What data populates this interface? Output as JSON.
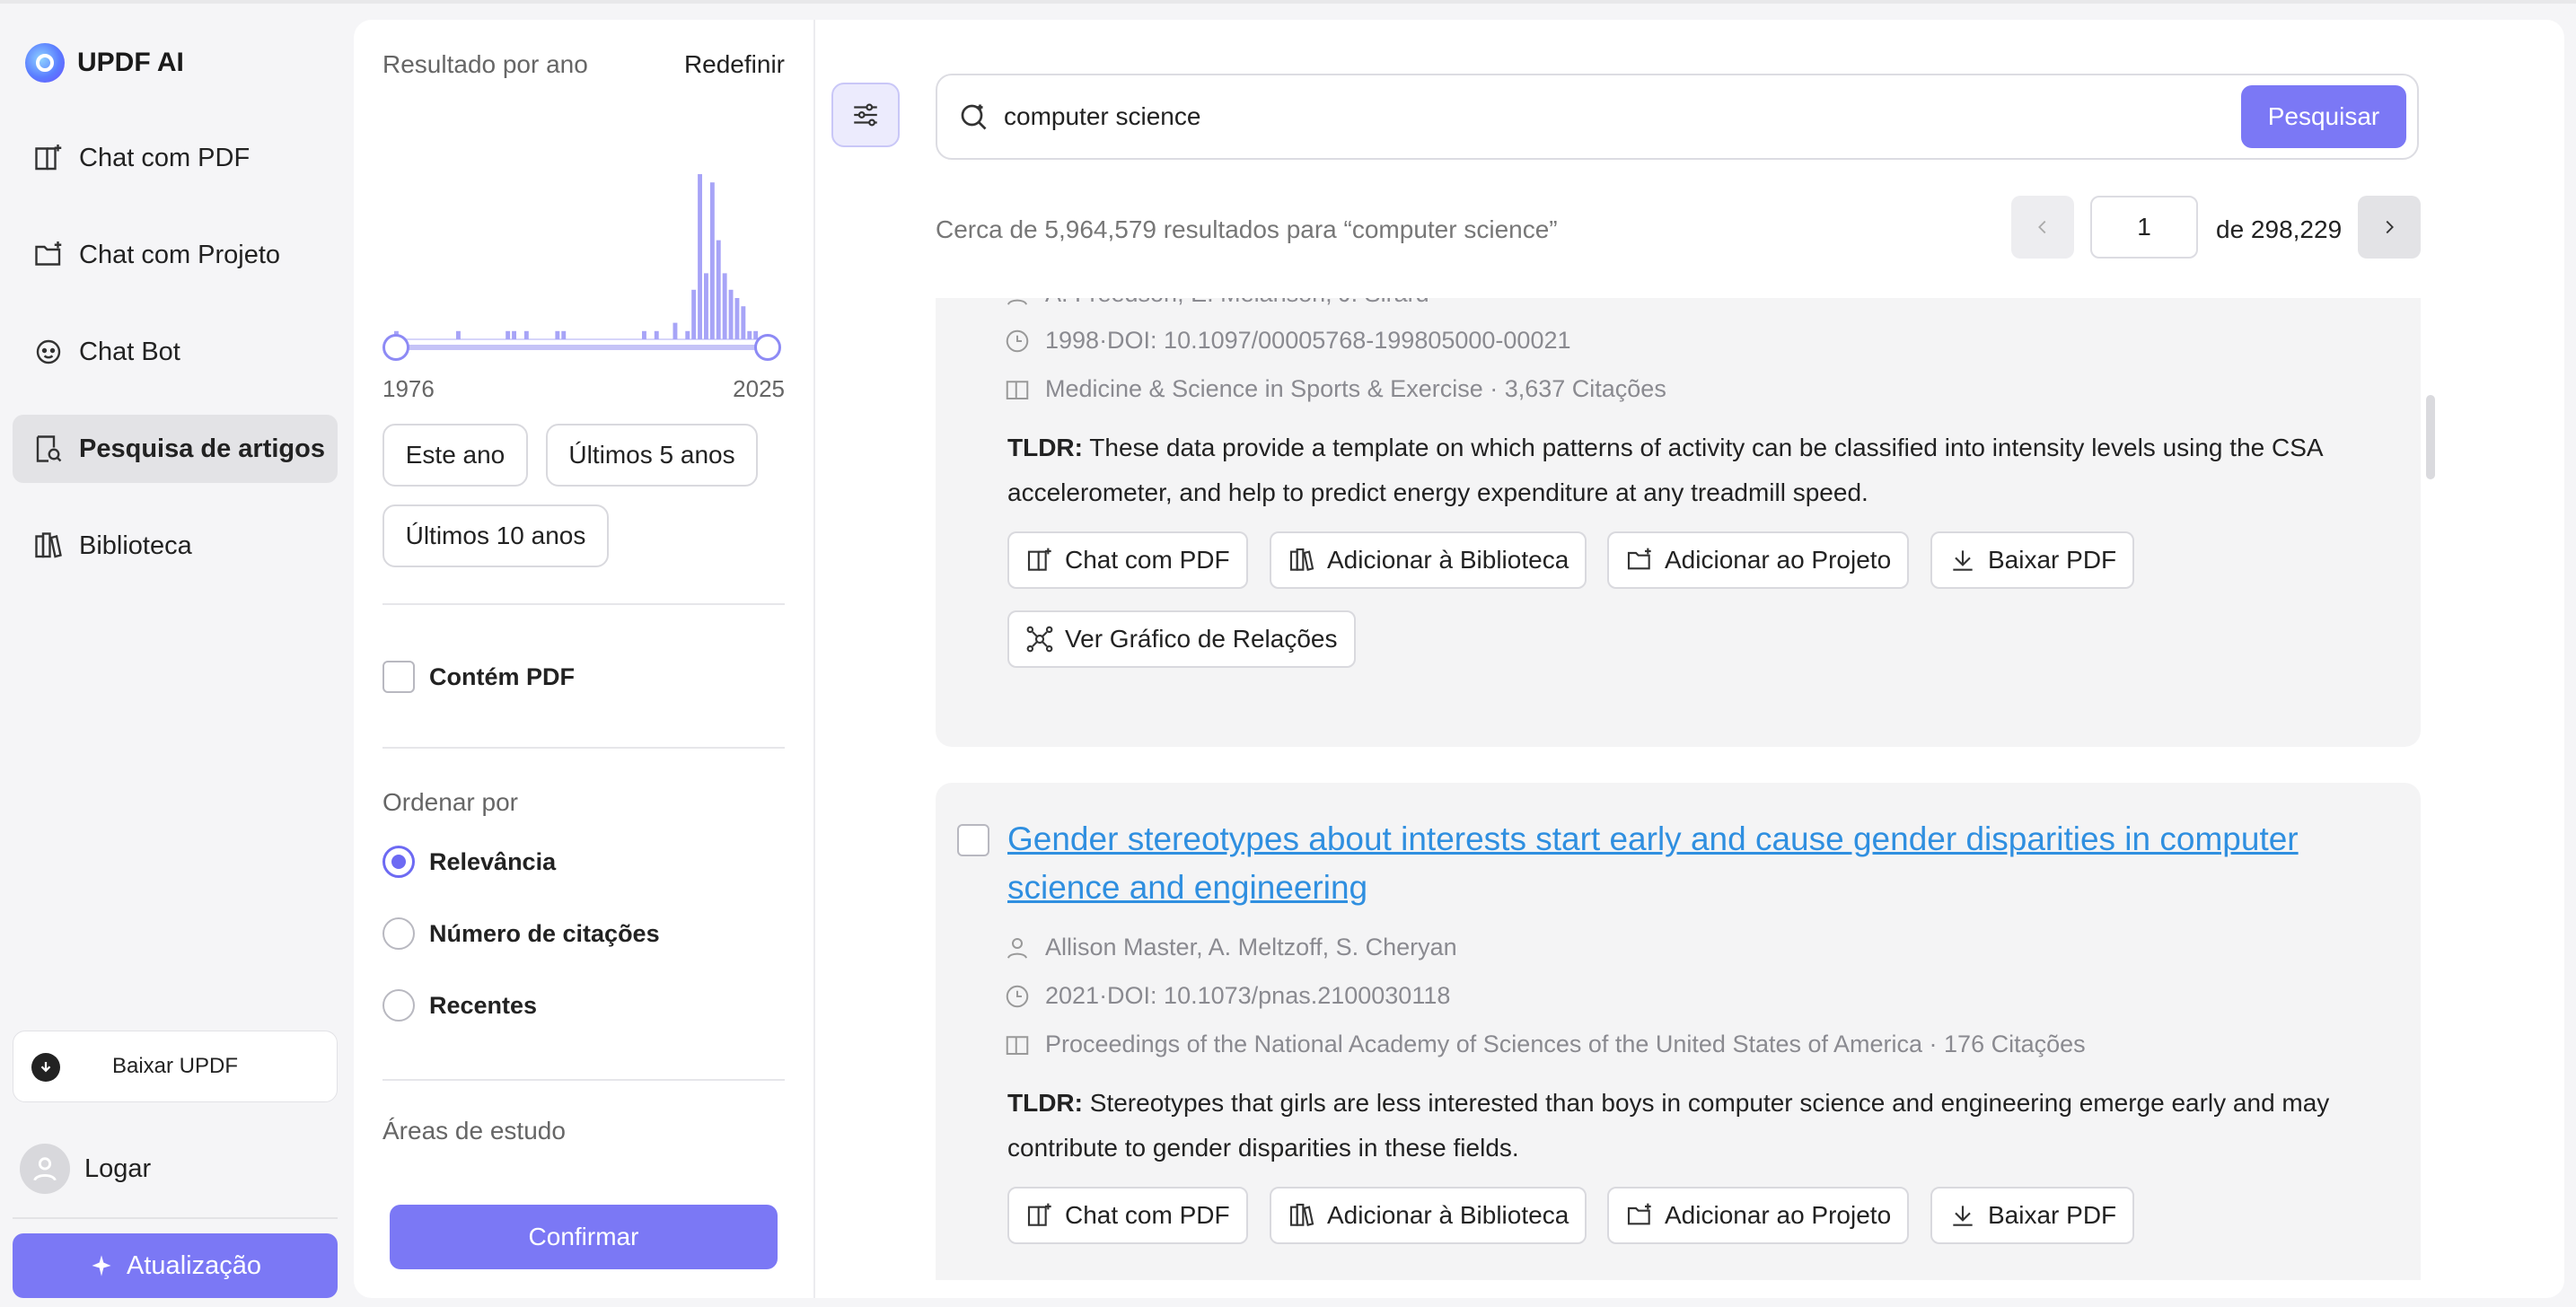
{
  "app": {
    "name": "UPDF AI"
  },
  "nav": {
    "items": [
      {
        "label": "Chat com PDF",
        "icon": "chat-pdf-icon"
      },
      {
        "label": "Chat com Projeto",
        "icon": "folder-plus-icon"
      },
      {
        "label": "Chat Bot",
        "icon": "bot-icon"
      },
      {
        "label": "Pesquisa de artigos",
        "icon": "search-doc-icon",
        "active": true
      },
      {
        "label": "Biblioteca",
        "icon": "library-icon"
      }
    ],
    "download_label": "Baixar UPDF",
    "login_label": "Logar",
    "upgrade_label": "Atualização"
  },
  "filter": {
    "year_title": "Resultado por ano",
    "reset_label": "Redefinir",
    "year_min": "1976",
    "year_max": "2025",
    "quick": [
      "Este ano",
      "Últimos 5 anos",
      "Últimos 10 anos"
    ],
    "has_pdf_label": "Contém PDF",
    "sort_title": "Ordenar por",
    "sort_options": [
      "Relevância",
      "Número de citações",
      "Recentes"
    ],
    "sort_selected": "Relevância",
    "areas_title": "Áreas de estudo",
    "confirm_label": "Confirmar",
    "histogram": [
      0.05,
      0,
      0,
      0,
      0,
      0,
      0,
      0,
      0,
      0,
      0.05,
      0,
      0,
      0,
      0,
      0,
      0,
      0,
      0.05,
      0.05,
      0,
      0.05,
      0,
      0,
      0,
      0,
      0.05,
      0.05,
      0,
      0,
      0,
      0,
      0,
      0,
      0,
      0,
      0,
      0,
      0,
      0,
      0.05,
      0,
      0.05,
      0,
      0,
      0.1,
      0,
      0.05,
      0.3,
      1.0,
      0.4,
      0.95,
      0.6,
      0.4,
      0.3,
      0.25,
      0.2,
      0.05,
      0.05,
      0
    ]
  },
  "search": {
    "query": "computer science",
    "button": "Pesquisar",
    "count_text": "Cerca de 5,964,579 resultados para “computer science”",
    "page": "1",
    "page_of": "de 298,229"
  },
  "results": [
    {
      "authors_partial": "A. Freedson,  E. Melanson,  J. Sirard",
      "doi": "1998·DOI: 10.1097/00005768-199805000-00021",
      "venue": "Medicine & Science in Sports & Exercise · 3,637 Citações",
      "tldr_label": "TLDR:",
      "tldr": "These data provide a template on which patterns of activity can be classified into intensity levels using the CSA accelerometer, and help to predict energy expenditure at any treadmill speed.",
      "actions": [
        "Chat com PDF",
        "Adicionar à Biblioteca",
        "Adicionar ao Projeto",
        "Baixar PDF",
        "Ver Gráfico de Relações"
      ]
    },
    {
      "title": "Gender stereotypes about interests start early and cause gender disparities in computer science and engineering",
      "authors": "Allison Master,  A. Meltzoff,  S. Cheryan",
      "doi": "2021·DOI: 10.1073/pnas.2100030118",
      "venue": "Proceedings of the National Academy of Sciences of the United States of America · 176 Citações",
      "tldr_label": "TLDR:",
      "tldr": "Stereotypes that girls are less interested than boys in computer science and engineering emerge early and may contribute to gender disparities in these fields.",
      "actions": [
        "Chat com PDF",
        "Adicionar à Biblioteca",
        "Adicionar ao Projeto",
        "Baixar PDF"
      ]
    }
  ],
  "colors": {
    "accent": "#7b78f5",
    "link": "#2f8fe0"
  }
}
